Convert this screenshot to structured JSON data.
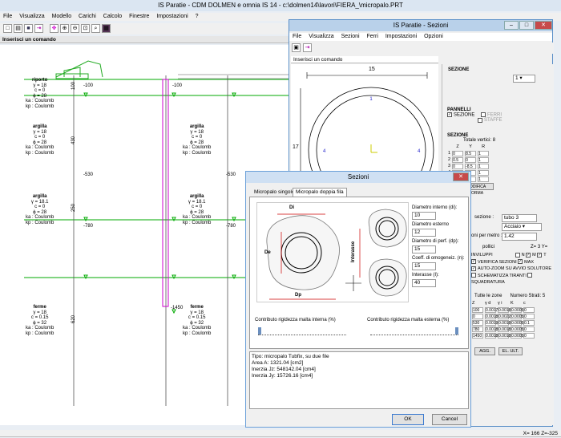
{
  "main": {
    "title": "IS Paratie - CDM DOLMEN e omnia IS 14 - c:\\dolmen14\\lavori\\FIERA_\\micropalo.PRT",
    "menu": [
      "File",
      "Visualizza",
      "Modello",
      "Carichi",
      "Calcolo",
      "Finestre",
      "Impostazioni",
      "?"
    ],
    "command": "Inserisci un comando",
    "status": "X= 166 Z=-325",
    "soils": [
      {
        "name": "riporto",
        "p": "γ = 18\nc = 0\nϕ = 28\nka : Coulomb\nkp : Coulomb"
      },
      {
        "name": "argilla",
        "p": "γ = 18\nc = 0\nϕ = 28\nka : Coulomb\nkp : Coulomb"
      },
      {
        "name": "argilla",
        "p": "γ = 18.1\nc = 0\nϕ = 28\nka : Coulomb\nkp : Coulomb"
      },
      {
        "name": "ferme",
        "p": "γ = 18\nc = 0.15\nϕ = 32\nka : Coulomb\nkp : Coulomb"
      }
    ],
    "depths_left": [
      "-100",
      "-530",
      "-780"
    ],
    "depths_right": [
      "-100",
      "-530",
      "-780",
      "-1450"
    ],
    "thick": [
      "100",
      "430",
      "250",
      "620"
    ]
  },
  "sez": {
    "title": "IS Paratie - Sezioni",
    "menu": [
      "File",
      "Visualizza",
      "Sezioni",
      "Ferri",
      "Impostazioni",
      "Opzioni"
    ],
    "command": "Inserisci un comando",
    "dim_top": "15",
    "dim_left": "17",
    "sezione_label": "SEZIONE",
    "sezione_val": "1",
    "pannelli_label": "PANNELLI",
    "pan_sezione": "SEZIONE",
    "pan_ferri": "FERRI",
    "pan_staffe": "STAFFE",
    "sez2_label": "SEZIONE",
    "totale": "Totale vertici:",
    "totale_n": "8",
    "cols": [
      "Z",
      "Y",
      "R"
    ],
    "rows": [
      [
        "1",
        "0",
        "8.5",
        "1"
      ],
      [
        "2",
        "0.5",
        "0",
        "1"
      ],
      [
        "3",
        "0",
        "-8.5",
        "1"
      ],
      [
        "4",
        "-8",
        "0",
        "1"
      ],
      [
        "5",
        "0",
        "8.5",
        "1"
      ]
    ],
    "modifica": "MODIFICA FORMA",
    "sezione_tipo_label": "sezione :",
    "sezione_tipo": "tubo 3",
    "materiale": "Acciaio",
    "ferri_label": "oni per metro :",
    "ferri_val": "1.42",
    "pollici": "pollici",
    "zy": "Z= 3 Y=",
    "inviluppi": "INVILUPPI",
    "nmt": [
      "N",
      "M",
      "T"
    ],
    "verifica": "VERIFICA SEZIONI",
    "max": "MAX",
    "autozoom": "AUTO-ZOOM SU AVVIO SOLUTORE",
    "schem": "SCHEMATIZZA TIRANTI",
    "squad": "SQUADRATURA",
    "tutte": "Tutte le zone",
    "numstrati": "Numero Strati:",
    "numstrati_v": "5",
    "tcols": [
      "Z",
      "γ d",
      "γ i",
      "K",
      "c"
    ],
    "trows": [
      [
        "100",
        "0.0017",
        "0.0018",
        "0.00050",
        "0"
      ],
      [
        "0",
        "0.0018",
        "0.0022",
        "0.00050",
        "0"
      ],
      [
        "530",
        "0.0019",
        "0.0018",
        "0.00050",
        "0.1"
      ],
      [
        "780",
        "0.0018",
        "0.0018",
        "0.00050",
        "0"
      ],
      [
        "1450",
        "0.0018",
        "0.0018",
        "0.00050",
        "0"
      ]
    ],
    "btn1": "AGG.",
    "btn2": "EL. ULT."
  },
  "dlg": {
    "title": "Sezioni",
    "tab1": "Micropalo singolo",
    "tab2": "Micropalo doppia fila",
    "di_label": "Diametro interno (di):",
    "di": "10",
    "de_label": "Diametro esterno",
    "de": "12",
    "dp_label": "Diametro di perf. (dp):",
    "dp": "15",
    "n_label": "Coeff. di omogeneiz. (n):",
    "n": "15",
    "i_label": "Interasse (I):",
    "i": "40",
    "img_di": "Di",
    "img_de": "De",
    "img_dp": "Dp",
    "img_int": "Interasse",
    "slider1": "Contributo rigidezza malta interna (%)",
    "slider2": "Contributo rigidezza malta esterna (%)",
    "slider1_v": 0.0,
    "slider2_v": 1.0,
    "info": [
      "Tipo: micropalo Tubfix, su due file",
      "Area A: 1321.04 [cm2]",
      "Inerzia Jz: 548142.04 [cm4]",
      "Inerzia Jy: 15726.16 [cm4]"
    ],
    "ok": "OK",
    "cancel": "Cancel"
  }
}
